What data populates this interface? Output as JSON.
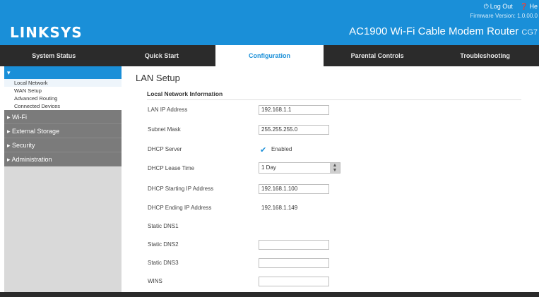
{
  "header": {
    "logo": "LINKSYS",
    "logout_label": "Log Out",
    "help_label": "He",
    "firmware": "Firmware Version: 1.0.00.0",
    "router_name": "AC1900 Wi-Fi Cable Modem Router",
    "router_model": "CG7"
  },
  "tabs": [
    "System Status",
    "Quick Start",
    "Configuration",
    "Parental Controls",
    "Troubleshooting"
  ],
  "active_tab": "Configuration",
  "sidebar": {
    "section": "",
    "subitems": [
      "Local Network",
      "WAN Setup",
      "Advanced Routing",
      "Connected Devices"
    ],
    "groups": [
      "Wi-Fi",
      "External Storage",
      "Security",
      "Administration"
    ]
  },
  "main": {
    "title": "LAN Setup",
    "section_title": "Local Network Information",
    "fields": {
      "lan_ip": {
        "label": "LAN IP Address",
        "value": "192.168.1.1"
      },
      "subnet": {
        "label": "Subnet Mask",
        "value": "255.255.255.0"
      },
      "dhcp_server": {
        "label": "DHCP Server",
        "value": "Enabled"
      },
      "lease_time": {
        "label": "DHCP Lease Time",
        "value": "1 Day"
      },
      "start_ip": {
        "label": "DHCP Starting IP Address",
        "value": "192.168.1.100"
      },
      "end_ip": {
        "label": "DHCP Ending IP Address",
        "value": "192.168.1.149"
      },
      "dns1": {
        "label": "Static DNS1",
        "value": ""
      },
      "dns2": {
        "label": "Static DNS2",
        "value": ""
      },
      "dns3": {
        "label": "Static DNS3",
        "value": ""
      },
      "wins": {
        "label": "WINS",
        "value": ""
      }
    }
  },
  "colors": {
    "brand_blue": "#1a8fd8",
    "tab_bar": "#2b2b2b",
    "sidebar_group": "#7b7b7b"
  }
}
